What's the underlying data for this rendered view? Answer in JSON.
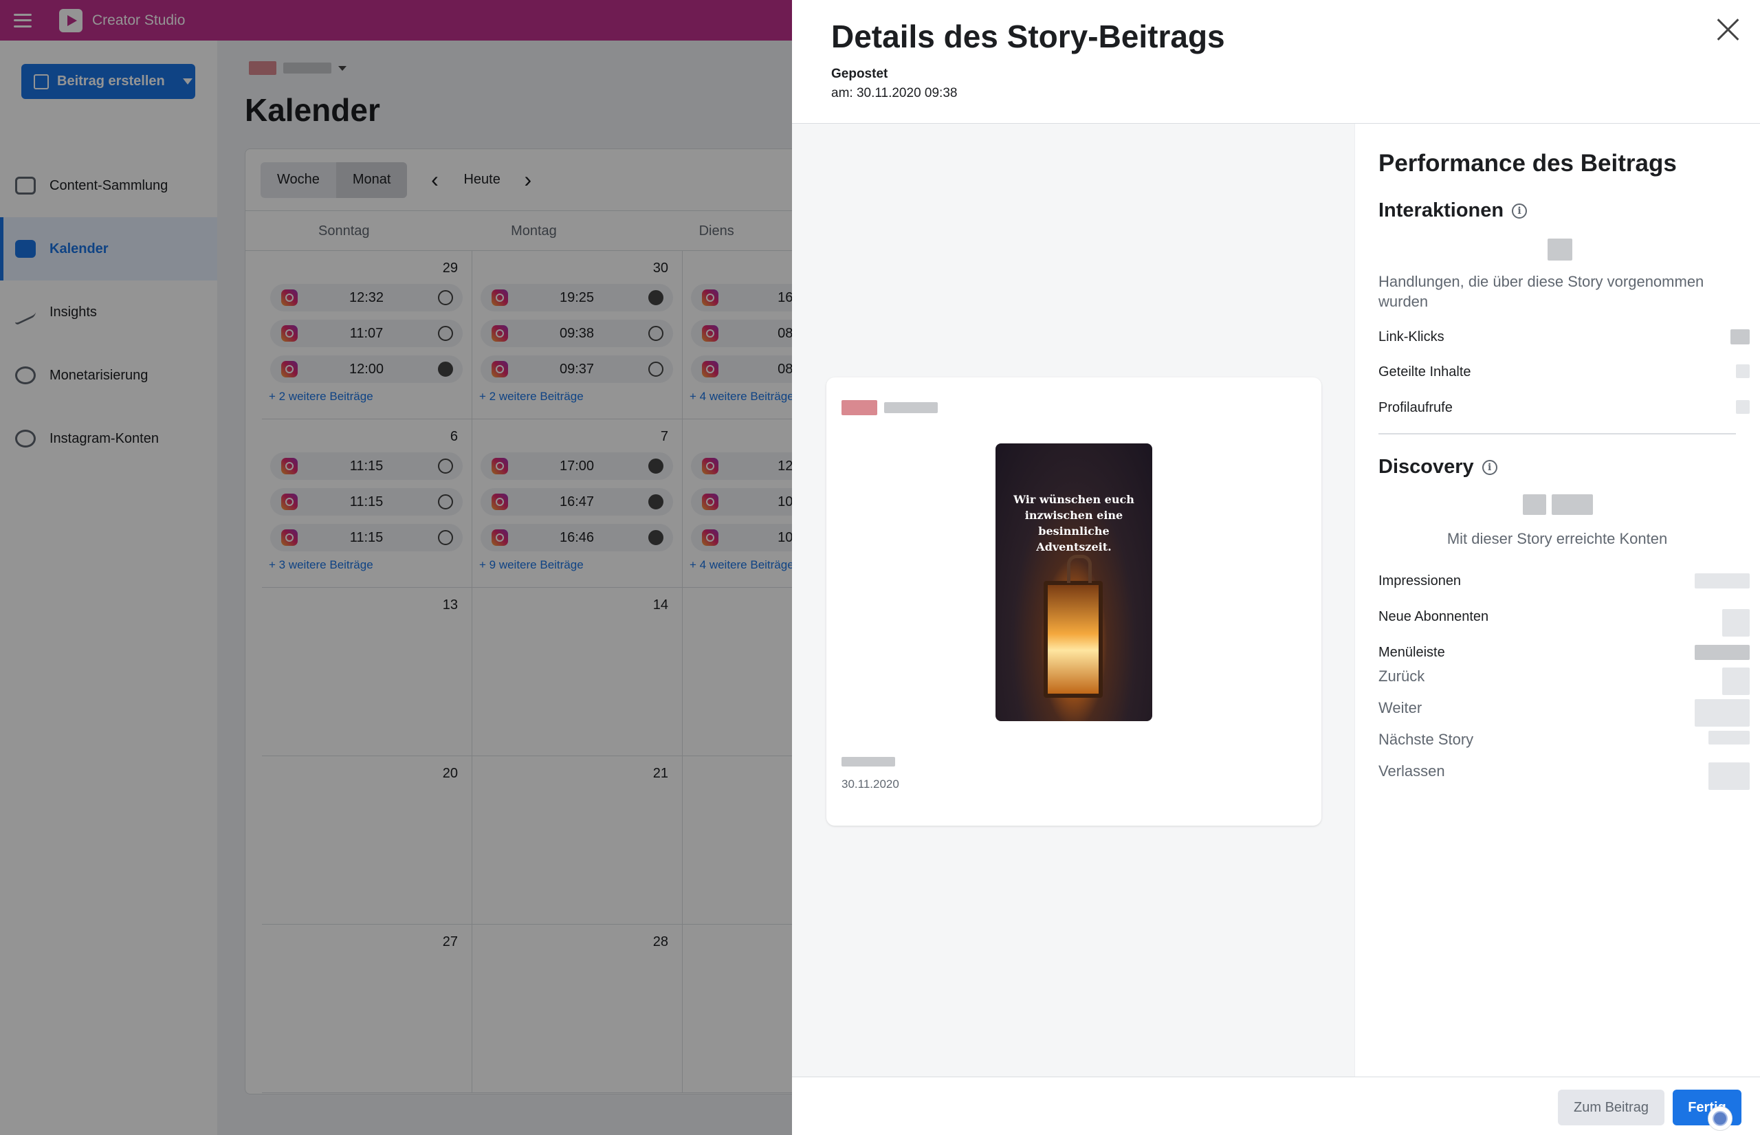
{
  "app": {
    "title": "Creator Studio",
    "brand_color": "#c0318e",
    "accent_color": "#1b74e4"
  },
  "sidebar": {
    "create_button": "Beitrag erstellen",
    "items": [
      {
        "label": "Content-Sammlung",
        "icon": "content-library-icon",
        "active": false
      },
      {
        "label": "Kalender",
        "icon": "calendar-icon",
        "active": true
      },
      {
        "label": "Insights",
        "icon": "insights-icon",
        "active": false
      },
      {
        "label": "Monetarisierung",
        "icon": "monetization-icon",
        "active": false
      },
      {
        "label": "Instagram-Konten",
        "icon": "instagram-accounts-icon",
        "active": false
      }
    ]
  },
  "main": {
    "title": "Kalender",
    "toolbar": {
      "week": "Woche",
      "month": "Monat",
      "today": "Heute",
      "prev": "‹",
      "next": "›"
    },
    "weekdays": [
      "Sonntag",
      "Montag",
      "Diens"
    ],
    "weeks": [
      {
        "days": [
          {
            "num": "29",
            "posts": [
              "12:32",
              "11:07",
              "12:00"
            ],
            "more": "+ 2 weitere Beiträge"
          },
          {
            "num": "30",
            "posts": [
              "19:25",
              "09:38",
              "09:37"
            ],
            "more": "+ 2 weitere Beiträge"
          },
          {
            "num": "",
            "posts": [
              "16:",
              "08:",
              "08:"
            ],
            "more": "+ 4 weitere Beiträge"
          }
        ]
      },
      {
        "days": [
          {
            "num": "6",
            "posts": [
              "11:15",
              "11:15",
              "11:15"
            ],
            "more": "+ 3 weitere Beiträge"
          },
          {
            "num": "7",
            "posts": [
              "17:00",
              "16:47",
              "16:46"
            ],
            "more": "+ 9 weitere Beiträge"
          },
          {
            "num": "",
            "posts": [
              "12:",
              "10:",
              "10:"
            ],
            "more": "+ 4 weitere Beiträge"
          }
        ]
      },
      {
        "days": [
          {
            "num": "13"
          },
          {
            "num": "14"
          },
          {
            "num": ""
          }
        ]
      },
      {
        "days": [
          {
            "num": "20"
          },
          {
            "num": "21"
          },
          {
            "num": ""
          }
        ]
      },
      {
        "days": [
          {
            "num": "27"
          },
          {
            "num": "28"
          },
          {
            "num": ""
          }
        ]
      }
    ]
  },
  "panel": {
    "title": "Details des Story-Beitrags",
    "posted_label": "Gepostet",
    "posted_date": "am: 30.11.2020 09:38",
    "story": {
      "text": "Wir wünschen euch inzwischen eine besinnliche Adventszeit.",
      "date": "30.11.2020"
    },
    "performance": {
      "title": "Performance des Beitrags",
      "interactions": {
        "title": "Interaktionen",
        "description": "Handlungen, die über diese Story vorgenommen wurden",
        "metrics": [
          "Link-Klicks",
          "Geteilte Inhalte",
          "Profilaufrufe"
        ]
      },
      "discovery": {
        "title": "Discovery",
        "description": "Mit dieser Story erreichte Konten",
        "metrics": [
          "Impressionen",
          "Neue Abonnenten",
          "Menüleiste"
        ],
        "nav_metrics": [
          "Zurück",
          "Weiter",
          "Nächste Story",
          "Verlassen"
        ]
      }
    },
    "footer": {
      "secondary": "Zum Beitrag",
      "primary": "Fertig"
    }
  }
}
